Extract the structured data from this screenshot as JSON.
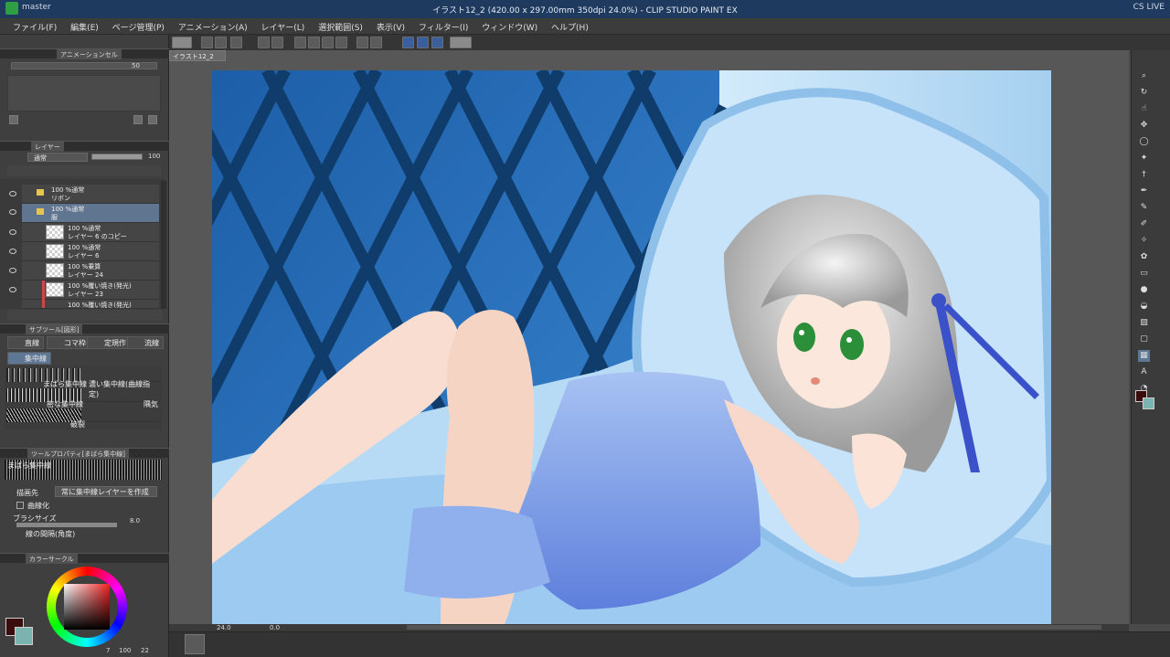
{
  "window": {
    "title": "イラスト12_2 (420.00 x 297.00mm 350dpi 24.0%) - CLIP STUDIO PAINT EX",
    "left_text": "master",
    "right_text": "CS LIVE"
  },
  "menu": [
    "ファイル(F)",
    "編集(E)",
    "ページ管理(P)",
    "アニメーション(A)",
    "レイヤー(L)",
    "選択範囲(S)",
    "表示(V)",
    "フィルター(I)",
    "ウィンドウ(W)",
    "ヘルプ(H)"
  ],
  "document_tab": "イラスト12_2",
  "panels": {
    "animation_cel_tab": "アニメーションセル",
    "layer_tab": "レイヤー",
    "blend_mode": "通常",
    "opacity": "100",
    "brush_opacity": "50",
    "subtool_tab": "サブツール[図形]",
    "tool_property_tab": "ツールプロパティ[まばら集中線]",
    "color_wheel_tab": "カラーサークル"
  },
  "layers": [
    {
      "line1": "100 %通常",
      "line2": "リボン"
    },
    {
      "line1": "100 %通常",
      "line2": "服"
    },
    {
      "line1": "100 %通常",
      "line2": "レイヤー 6 のコピー"
    },
    {
      "line1": "100 %通常",
      "line2": "レイヤー 6"
    },
    {
      "line1": "100 %乗算",
      "line2": "レイヤー 24"
    },
    {
      "line1": "100 %覆い焼き(発光)",
      "line2": "レイヤー 23"
    },
    {
      "line1": "100 %覆い焼き(発光)",
      "line2": ""
    }
  ],
  "subtool_tabs": [
    "直線",
    "コマ枠",
    "定規作",
    "流線"
  ],
  "subtool_selected": "集中線",
  "brushes": [
    {
      "name": "まばら集中線",
      "name2": "濃い集中線(曲線指定)"
    },
    {
      "name": "密な集中線",
      "name2": "隅気"
    },
    {
      "name": "",
      "name2": "破裂"
    }
  ],
  "tool_property": {
    "preview_label": "まばら集中線",
    "draw_target_label": "描画先",
    "draw_target_value": "常に集中線レイヤーを作成",
    "curve_label": "曲線化",
    "brush_size_label": "ブラシサイズ",
    "brush_size_value": "8.0",
    "line_spacing_label": "線の間隔(角度)"
  },
  "status": {
    "zoom": "24.0",
    "rotation": "0.0",
    "color_values": "7",
    "color_v2": "100",
    "color_v3": "22"
  },
  "colors": {
    "main_color": "#3a0c0c",
    "sub_color": "#7ab3b0",
    "accent": "#3a5f9e"
  }
}
